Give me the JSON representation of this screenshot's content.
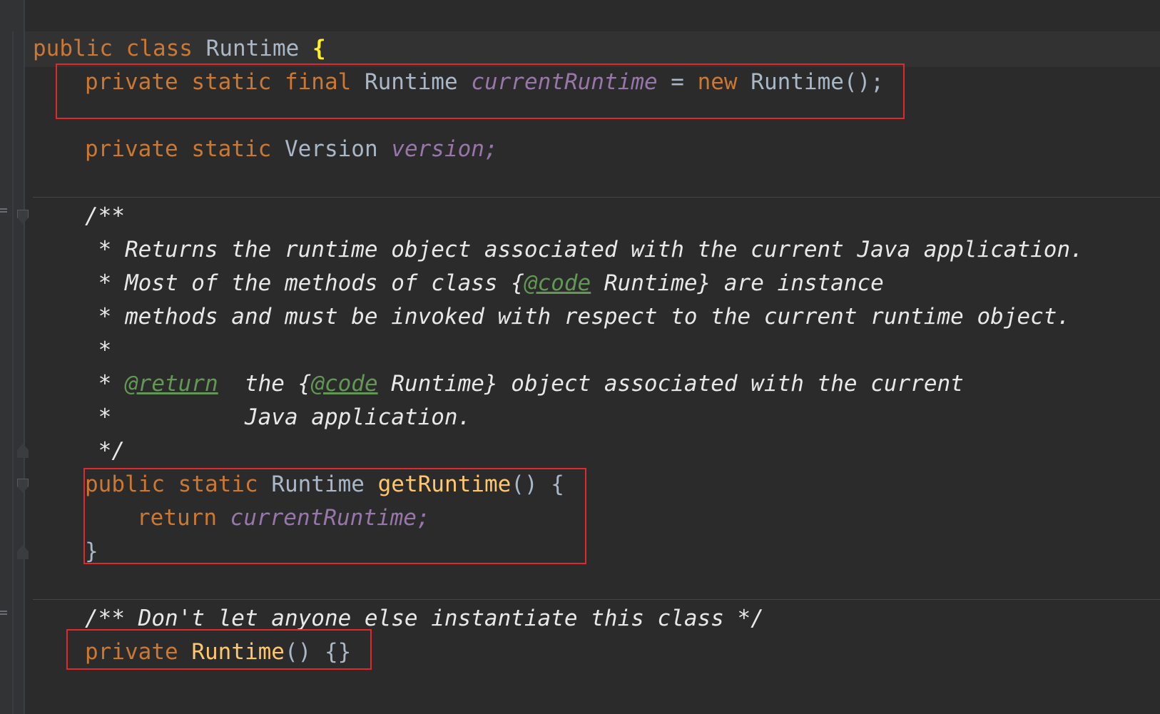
{
  "code": {
    "line1": {
      "kw1": "public",
      "kw2": "class",
      "name": "Runtime",
      "brace": "{"
    },
    "line2": {
      "kw1": "private",
      "kw2": "static",
      "kw3": "final",
      "type": "Runtime",
      "field": "currentRuntime",
      "op": " = ",
      "kw4": "new",
      "ctor": "Runtime();"
    },
    "line3": {
      "kw1": "private",
      "kw2": "static",
      "type": "Version",
      "field": "version;"
    },
    "doc": {
      "l1": "/**",
      "l2": " * Returns the runtime object associated with the current Java application.",
      "l3a": " * Most of the methods of class {",
      "l3tag": "@code",
      "l3b": " Runtime} are instance",
      "l4": " * methods and must be invoked with respect to the current runtime object.",
      "l5": " *",
      "l6a": " * ",
      "l6tag": "@return",
      "l6b": "  the {",
      "l6tag2": "@code",
      "l6c": " Runtime} object associated with the current",
      "l7": " *          Java application.",
      "l8": " */"
    },
    "method": {
      "kw1": "public",
      "kw2": "static",
      "type": "Runtime",
      "name": "getRuntime",
      "rest": "() {",
      "ret": "return",
      "field": "currentRuntime;",
      "close": "}"
    },
    "comment2": "/** Don't let anyone else instantiate this class */",
    "ctor": {
      "kw": "private",
      "name": "Runtime",
      "rest": "() {}"
    }
  },
  "colors": {
    "background": "#2b2b2b",
    "keyword": "#cc7832",
    "field": "#9876aa",
    "function": "#ffc66d",
    "doc_tag": "#629755",
    "highlight_box": "#e0282d"
  }
}
